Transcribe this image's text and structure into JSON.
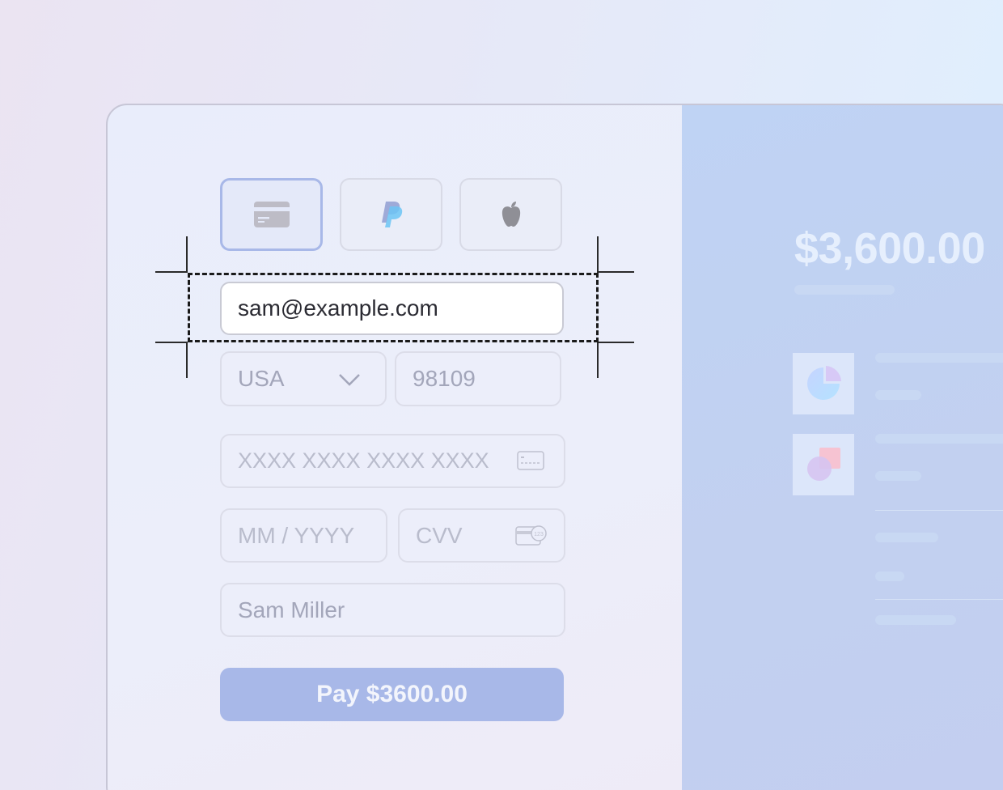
{
  "payment_methods": [
    {
      "name": "Card",
      "icon": "credit-card-icon",
      "selected": true
    },
    {
      "name": "PayPal",
      "icon": "paypal-icon",
      "selected": false
    },
    {
      "name": "Apple Pay",
      "icon": "apple-icon",
      "selected": false
    }
  ],
  "form": {
    "email_value": "sam@example.com",
    "country_value": "USA",
    "zip_value": "98109",
    "card_number_placeholder": "XXXX XXXX XXXX XXXX",
    "expiry_placeholder": "MM / YYYY",
    "cvv_placeholder": "CVV",
    "name_value": "Sam Miller",
    "pay_label": "Pay $3600.00"
  },
  "summary": {
    "amount": "$3,600.00"
  },
  "colors": {
    "accent": "#a8b8e8",
    "panel": "#c0d2f3",
    "selection": "#1a1a1a"
  }
}
